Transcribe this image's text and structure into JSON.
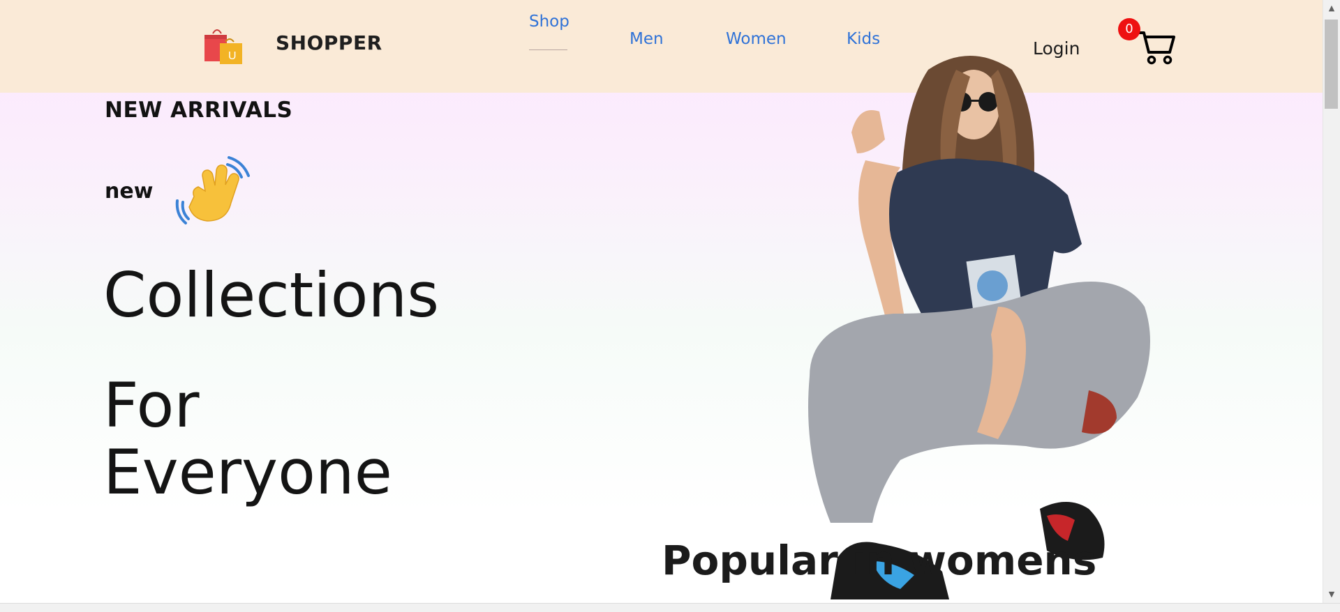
{
  "header": {
    "brand": "SHOPPER",
    "brand_icon": "shopping-bags-icon",
    "nav": [
      {
        "label": "Shop",
        "active": true
      },
      {
        "label": "Men",
        "active": false
      },
      {
        "label": "Women",
        "active": false
      },
      {
        "label": "Kids",
        "active": false
      }
    ],
    "login_label": "Login",
    "cart_count": "0",
    "cart_icon": "shopping-cart-icon"
  },
  "hero": {
    "label": "NEW ARRIVALS",
    "new_label": "new",
    "hand_icon": "waving-hand-icon",
    "headline_line1": "Collections",
    "headline_line2": "For",
    "headline_line3": "Everyone",
    "image": "hero-model-photo"
  },
  "section": {
    "title": "Popular in womens"
  },
  "colors": {
    "navbar_bg": "#faead7",
    "nav_link": "#2f72d7",
    "badge": "#ee1111",
    "hero_gradient_top": "#fce6ff"
  }
}
